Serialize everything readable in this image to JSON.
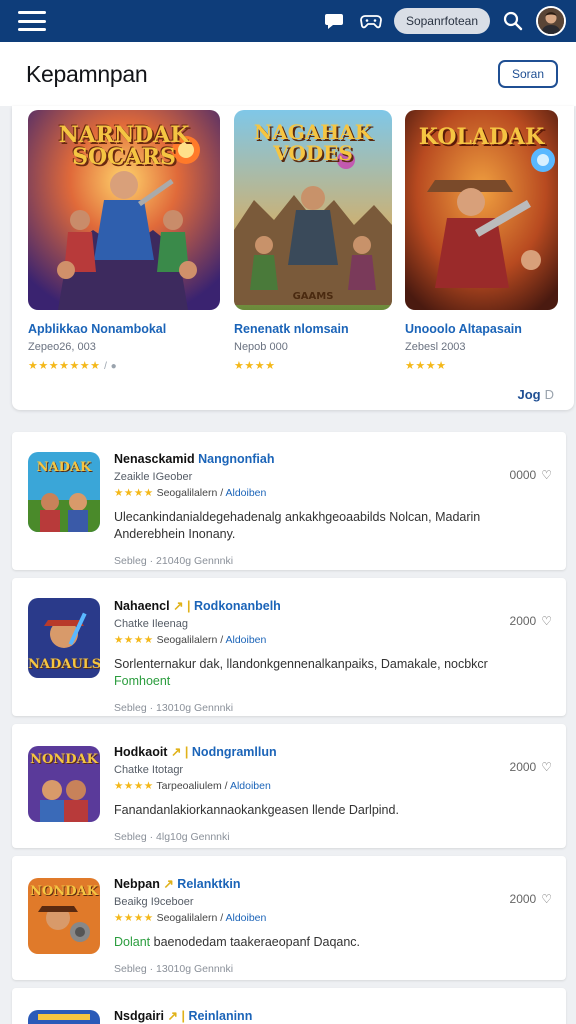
{
  "topbar": {
    "search_label": "Sopanrfotean",
    "icons": [
      "menu-icon",
      "chat-icon",
      "controller-icon",
      "search-icon",
      "avatar"
    ]
  },
  "header": {
    "title": "Kepamnpan",
    "button_label": "Soran"
  },
  "featured": {
    "cards": [
      {
        "art_text": "NARNDAK SOCARS",
        "title": "Apblikkao Nonambokal",
        "date": "Zepeo26, 003",
        "stars": "★★★★★★★",
        "extra": "/ ●"
      },
      {
        "art_text": "NAGAHAK VODES",
        "art_sub": "GAAMS",
        "title": "Renenatk nlomsain",
        "date": "Nepob 000",
        "stars": "★★★★",
        "extra": ""
      },
      {
        "art_text": "KOLADAK",
        "title": "Unooolo Altapasain",
        "date": "Zebesl 2003",
        "stars": "★★★★",
        "extra": ""
      }
    ],
    "more_label": "Jog",
    "more_arrow": "D"
  },
  "list": [
    {
      "icon_text": "NADAK",
      "title": "Nenasckamid",
      "sep": "",
      "publisher": "Nangnonfiah",
      "sub": "Zeaikle  IGeober",
      "stars": "★★★★",
      "category": "Seogalilalern",
      "tag": "Aldoiben",
      "desc": "Ulecankindanialdegehadenalg ankakhgeoaabilds Nolcan, Madarin Anderebhein Inonany.",
      "desc_hl": "",
      "date": "Sebleg · 21040g  Gennnki",
      "count": "0000"
    },
    {
      "icon_text": "NADAULS",
      "title": "Nahaencl",
      "sep": "↗ |",
      "publisher": "Rodkonanbelh",
      "sub": "Chatke  Ileenag",
      "stars": "★★★★",
      "category": "Seogalilalern",
      "tag": "Aldoiben",
      "desc": "Sorlenternakur dak, llandonkgennenalkanpaiks, Damakale, nocbkcr",
      "desc_hl": "Fomhoent",
      "date": "Sebleg · 13010g  Gennnki",
      "count": "2000"
    },
    {
      "icon_text": "NONDAK",
      "title": "Hodkaoit",
      "sep": "↗ |",
      "publisher": "Nodngramllun",
      "sub": "Chatke  Itotagr",
      "stars": "★★★★",
      "category": "Tarpeoaliulem",
      "tag": "Aldoiben",
      "desc": "Fanandanlakiorkannaokankgeasen llende Darlpind.",
      "desc_hl": "",
      "date": "Sebleg · 4lg10g  Gennnki",
      "count": "2000"
    },
    {
      "icon_text": "NONDAK",
      "title": "Nebpan",
      "sep": "↗",
      "publisher": "Relanktkin",
      "sub": "Beaikg  I9ceboer",
      "stars": "★★★★",
      "category": "Seogalilalern",
      "tag": "Aldoiben",
      "desc": "baenodedam taakeraeopanf Daqanc.",
      "desc_hl": "Dolant",
      "date": "Sebleg · 13010g  Gennnki",
      "count": "2000"
    },
    {
      "icon_text": "NONDAK",
      "title": "Nsdgairi",
      "sep": "↗ |",
      "publisher": "Reinlaninn",
      "sub": "",
      "stars": "",
      "category": "",
      "tag": "",
      "desc": "",
      "desc_hl": "",
      "date": "",
      "count": ""
    }
  ],
  "colors": {
    "topbar": "#0e3d7a",
    "accent": "#1b64b8",
    "star": "#f4b81a",
    "highlight": "#2b9d3e"
  }
}
